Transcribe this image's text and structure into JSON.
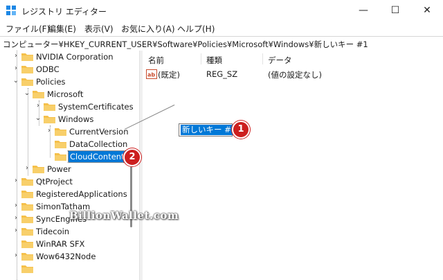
{
  "window": {
    "title": "レジストリ エディター",
    "minimize_glyph": "—",
    "maximize_glyph": "☐",
    "close_glyph": "✕"
  },
  "menu": [
    "ファイル(F)",
    "編集(E)",
    "表示(V)",
    "お気に入り(A)",
    "ヘルプ(H)"
  ],
  "address": "コンピューター¥HKEY_CURRENT_USER¥Software¥Policies¥Microsoft¥Windows¥新しいキー #1",
  "tree": [
    {
      "label": "NVIDIA Corporation",
      "chevron": "›"
    },
    {
      "label": "ODBC",
      "chevron": "›"
    },
    {
      "label": "Policies",
      "chevron": "⌄"
    },
    {
      "label": "Microsoft",
      "chevron": "⌄"
    },
    {
      "label": "SystemCertificates",
      "chevron": "›"
    },
    {
      "label": "Windows",
      "chevron": "⌄"
    },
    {
      "label": "CurrentVersion",
      "chevron": "›"
    },
    {
      "label": "DataCollection",
      "chevron": ""
    },
    {
      "label": "CloudContent",
      "chevron": ""
    },
    {
      "label": "Power",
      "chevron": "›"
    },
    {
      "label": "QtProject",
      "chevron": "›"
    },
    {
      "label": "RegisteredApplications",
      "chevron": ""
    },
    {
      "label": "SimonTatham",
      "chevron": "›"
    },
    {
      "label": "SyncEngines",
      "chevron": "›"
    },
    {
      "label": "Tidecoin",
      "chevron": "›"
    },
    {
      "label": "WinRAR SFX",
      "chevron": ""
    },
    {
      "label": "Wow6432Node",
      "chevron": "›"
    },
    {
      "label": "",
      "chevron": ""
    }
  ],
  "list": {
    "columns": {
      "name": "名前",
      "type": "種類",
      "data": "データ"
    },
    "rows": [
      {
        "name": "(既定)",
        "type": "REG_SZ",
        "data": "(値の設定なし)",
        "icon": "ab"
      }
    ]
  },
  "new_key_edit_value": "新しいキー #1",
  "selected_key": "CloudContent",
  "callouts": [
    "1",
    "2"
  ],
  "watermark": "BillionWallet.com",
  "colors": {
    "selection": "#0078d7",
    "callout": "#cc1f1f",
    "folder": "#f5c04a"
  }
}
